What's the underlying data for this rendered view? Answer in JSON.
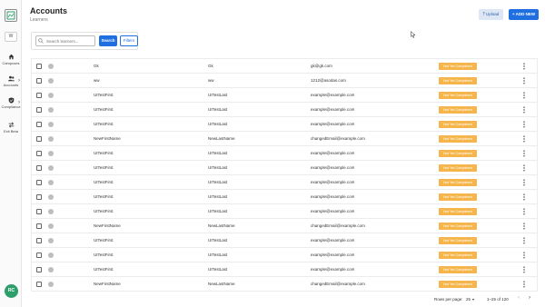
{
  "sidebar": {
    "workspace_letter": "W",
    "items": [
      {
        "label": "Campuses",
        "icon": "home-icon"
      },
      {
        "label": "Accounts",
        "icon": "people-icon"
      },
      {
        "label": "Compliance",
        "icon": "shield-check-icon"
      },
      {
        "label": "Exit Beta",
        "icon": "swap-arrows-icon"
      }
    ],
    "avatar_initials": "RC"
  },
  "header": {
    "title": "Accounts",
    "subtitle": "Learners",
    "upload_label": "Upload",
    "add_new_label": "ADD NEW"
  },
  "filter": {
    "search_placeholder": "Search learners...",
    "search_button": "Search",
    "filters_button": "Filters"
  },
  "table": {
    "rows": [
      {
        "first": "Gk",
        "last": "Gk",
        "email": "gk@gk.com",
        "status": "Not Yet Completed"
      },
      {
        "first": "ww",
        "last": "ww",
        "email": "1212@asodas.com",
        "status": "Not Yet Completed"
      },
      {
        "first": "UITestFirst",
        "last": "UITestLast",
        "email": "example@example.com",
        "status": "Not Yet Completed"
      },
      {
        "first": "UITestFirst",
        "last": "UITestLast",
        "email": "example@example.com",
        "status": "Not Yet Completed"
      },
      {
        "first": "UITestFirst",
        "last": "UITestLast",
        "email": "example@example.com",
        "status": "Not Yet Completed"
      },
      {
        "first": "NewFirstName",
        "last": "NewLastName",
        "email": "changedEmail@example.com",
        "status": "Not Yet Completed"
      },
      {
        "first": "UITestFirst",
        "last": "UITestLast",
        "email": "example@example.com",
        "status": "Not Yet Completed"
      },
      {
        "first": "UITestFirst",
        "last": "UITestLast",
        "email": "example@example.com",
        "status": "Not Yet Completed"
      },
      {
        "first": "UITestFirst",
        "last": "UITestLast",
        "email": "example@example.com",
        "status": "Not Yet Completed"
      },
      {
        "first": "UITestFirst",
        "last": "UITestLast",
        "email": "example@example.com",
        "status": "Not Yet Completed"
      },
      {
        "first": "UITestFirst",
        "last": "UITestLast",
        "email": "example@example.com",
        "status": "Not Yet Completed"
      },
      {
        "first": "NewFirstName",
        "last": "NewLastName",
        "email": "changedEmail@example.com",
        "status": "Not Yet Completed"
      },
      {
        "first": "UITestFirst",
        "last": "UITestLast",
        "email": "example@example.com",
        "status": "Not Yet Completed"
      },
      {
        "first": "UITestFirst",
        "last": "UITestLast",
        "email": "example@example.com",
        "status": "Not Yet Completed"
      },
      {
        "first": "UITestFirst",
        "last": "UITestLast",
        "email": "example@example.com",
        "status": "Not Yet Completed"
      },
      {
        "first": "NewFirstName",
        "last": "NewLastName",
        "email": "changedEmail@example.com",
        "status": "Not Yet Completed"
      }
    ]
  },
  "pagination": {
    "rows_per_page_label": "Rows per page:",
    "rows_per_page": "25",
    "range": "1–25 of 120"
  },
  "colors": {
    "primary": "#1f6fe0",
    "badge": "#f5b54a",
    "avatar": "#2e9e6b"
  }
}
